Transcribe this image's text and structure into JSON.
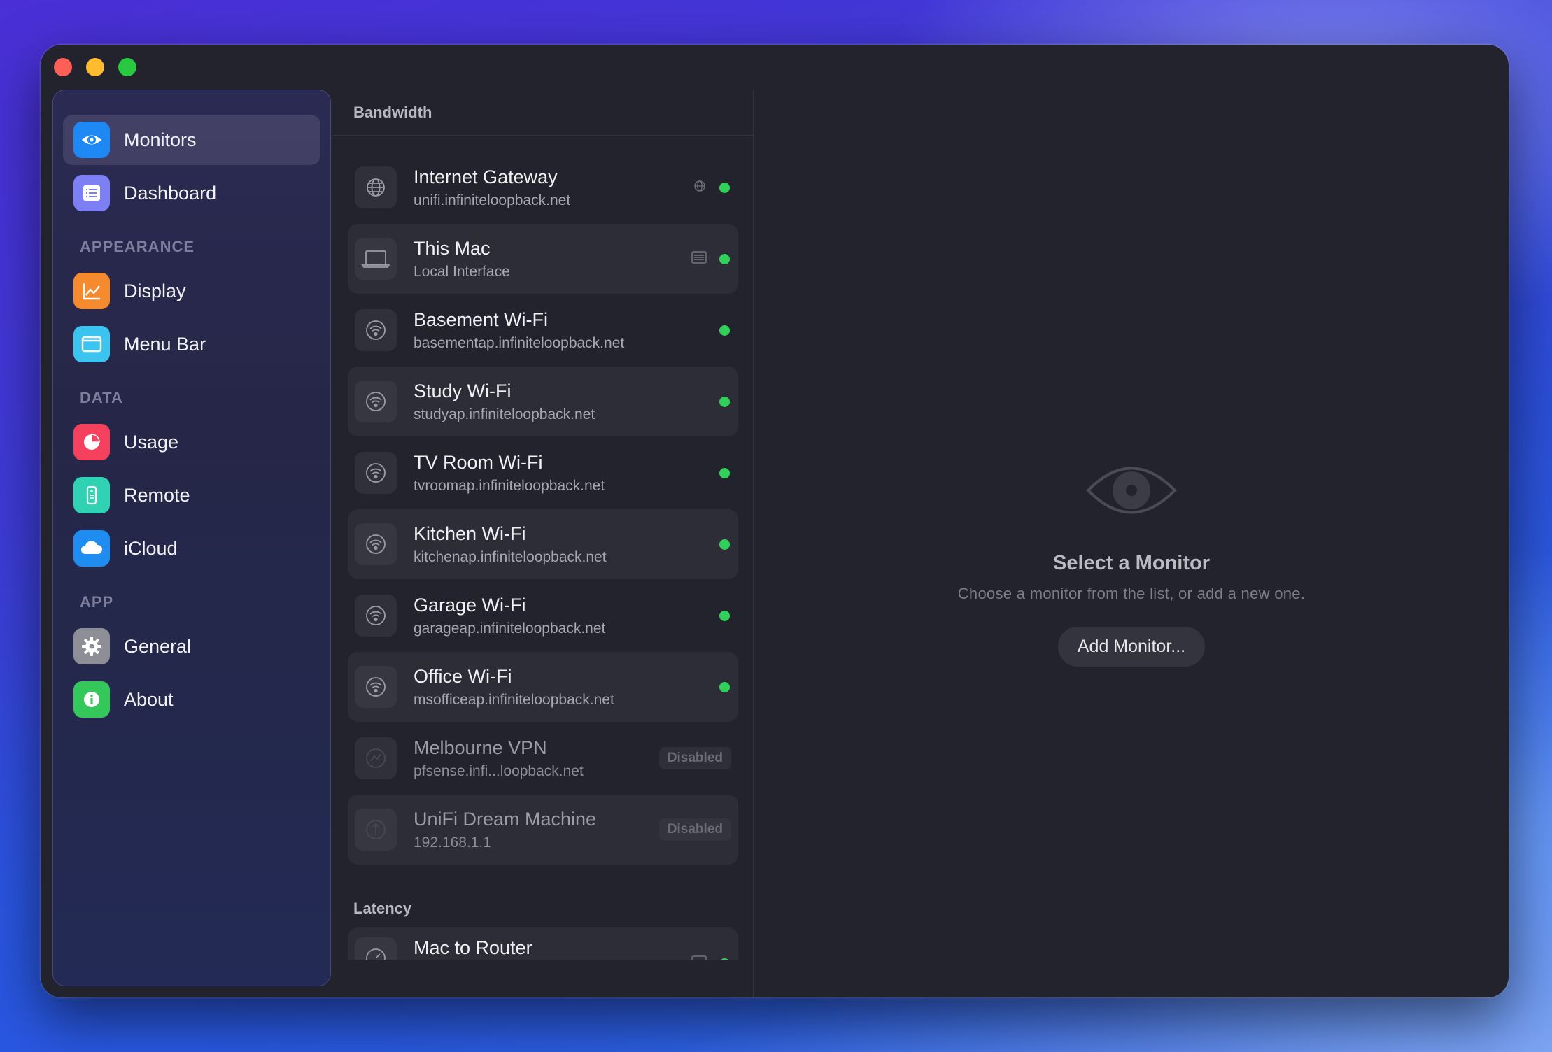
{
  "sidebar": {
    "items": [
      {
        "label": "Monitors"
      },
      {
        "label": "Dashboard"
      },
      {
        "label": "Display"
      },
      {
        "label": "Menu Bar"
      },
      {
        "label": "Usage"
      },
      {
        "label": "Remote"
      },
      {
        "label": "iCloud"
      },
      {
        "label": "General"
      },
      {
        "label": "About"
      }
    ],
    "sections": [
      "APPEARANCE",
      "DATA",
      "APP"
    ]
  },
  "list": {
    "bandwidth_title": "Bandwidth",
    "latency_title": "Latency",
    "bandwidth": [
      {
        "title": "Internet Gateway",
        "sub": "unifi.infiniteloopback.net"
      },
      {
        "title": "This Mac",
        "sub": "Local Interface"
      },
      {
        "title": "Basement Wi-Fi",
        "sub": "basementap.infiniteloopback.net"
      },
      {
        "title": "Study Wi-Fi",
        "sub": "studyap.infiniteloopback.net"
      },
      {
        "title": "TV Room Wi-Fi",
        "sub": "tvroomap.infiniteloopback.net"
      },
      {
        "title": "Kitchen Wi-Fi",
        "sub": "kitchenap.infiniteloopback.net"
      },
      {
        "title": "Garage Wi-Fi",
        "sub": "garageap.infiniteloopback.net"
      },
      {
        "title": "Office Wi-Fi",
        "sub": "msofficeap.infiniteloopback.net"
      },
      {
        "title": "Melbourne VPN",
        "sub": "pfsense.infi...loopback.net",
        "badge": "Disabled"
      },
      {
        "title": "UniFi Dream Machine",
        "sub": "192.168.1.1",
        "badge": "Disabled"
      }
    ],
    "latency": [
      {
        "title": "Mac to Router"
      }
    ]
  },
  "toolbar": {
    "add": "+",
    "remove": "—"
  },
  "detail": {
    "title": "Select a Monitor",
    "subtitle": "Choose a monitor from the list, or add a new one.",
    "button": "Add Monitor..."
  },
  "colors": {
    "status_online": "#30d158",
    "accent": "#1e88f5"
  }
}
